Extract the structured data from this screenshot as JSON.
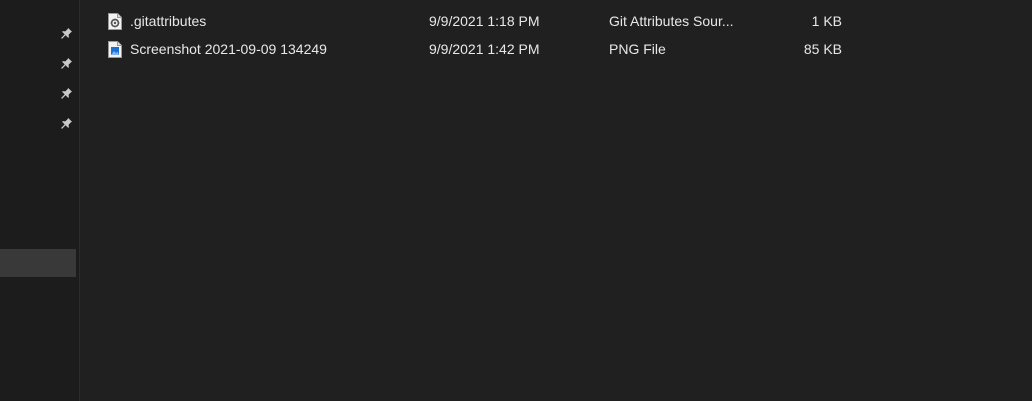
{
  "navigation": {
    "pinned_items": [
      {
        "icon": "pin-icon"
      },
      {
        "icon": "pin-icon"
      },
      {
        "icon": "pin-icon"
      },
      {
        "icon": "pin-icon"
      }
    ],
    "selected_index": 0
  },
  "files": [
    {
      "name": ".gitattributes",
      "date_modified": "9/9/2021 1:18 PM",
      "type": "Git Attributes Sour...",
      "size": "1 KB",
      "icon": "settings-file-icon"
    },
    {
      "name": "Screenshot 2021-09-09 134249",
      "date_modified": "9/9/2021 1:42 PM",
      "type": "PNG File",
      "size": "85 KB",
      "icon": "image-file-icon"
    }
  ],
  "colors": {
    "background": "#202020",
    "nav_background": "#1c1c1c",
    "selection": "#393939",
    "text": "#e8e8e8",
    "image_icon_accent": "#1e6fd0"
  }
}
